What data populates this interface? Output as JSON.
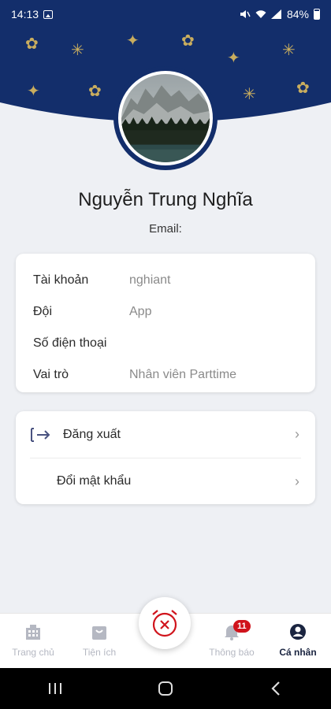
{
  "status": {
    "time": "14:13",
    "battery": "84%",
    "icons": [
      "image-icon",
      "mute-icon",
      "wifi-icon",
      "signal-icon",
      "battery-icon"
    ]
  },
  "profile": {
    "name": "Nguyễn Trung Nghĩa",
    "email_label": "Email:"
  },
  "info": [
    {
      "label": "Tài khoản",
      "value": "nghiant"
    },
    {
      "label": "Đội",
      "value": "App"
    },
    {
      "label": "Số điện thoại",
      "value": ""
    },
    {
      "label": "Vai trò",
      "value": "Nhân viên Parttime"
    }
  ],
  "actions": {
    "logout": "Đăng xuất",
    "change_password": "Đổi mật khẩu"
  },
  "nav": {
    "home": "Trang chủ",
    "utilities": "Tiện ích",
    "notifications": "Thông báo",
    "notifications_badge": "11",
    "personal": "Cá nhân"
  },
  "colors": {
    "header": "#132e6b",
    "decor": "#c9ad5e",
    "accent_red": "#d0141c"
  }
}
